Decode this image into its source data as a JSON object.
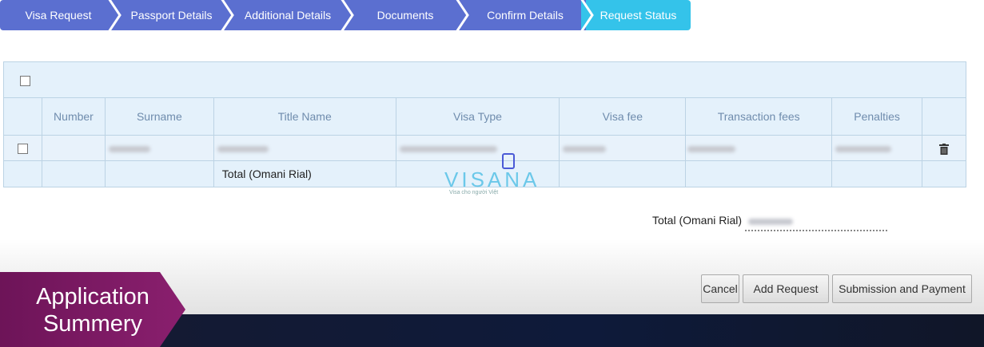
{
  "steps": [
    {
      "label": "Visa Request",
      "active": false
    },
    {
      "label": "Passport Details",
      "active": false
    },
    {
      "label": "Additional Details",
      "active": false
    },
    {
      "label": "Documents",
      "active": false
    },
    {
      "label": "Confirm Details",
      "active": false
    },
    {
      "label": "Request Status",
      "active": true
    }
  ],
  "table": {
    "columns": [
      "Number",
      "Surname",
      "Title Name",
      "Visa Type",
      "Visa fee",
      "Transaction fees",
      "Penalties"
    ],
    "total_label": "Total (Omani Rial)"
  },
  "watermark": {
    "brand": "VISANA",
    "tagline": "Visa cho người Việt"
  },
  "summary": {
    "total_label": "Total (Omani Rial)"
  },
  "buttons": {
    "cancel": "Cancel",
    "add_request": "Add Request",
    "submit": "Submission and Payment"
  },
  "overlay": {
    "line1": "Application",
    "line2": "Summery"
  },
  "colors": {
    "step": "#5b6fd0",
    "step_active": "#34c3ea",
    "table_bg": "#e4f1fb",
    "header_text": "#6f8cad",
    "badge": "#7a1960"
  }
}
